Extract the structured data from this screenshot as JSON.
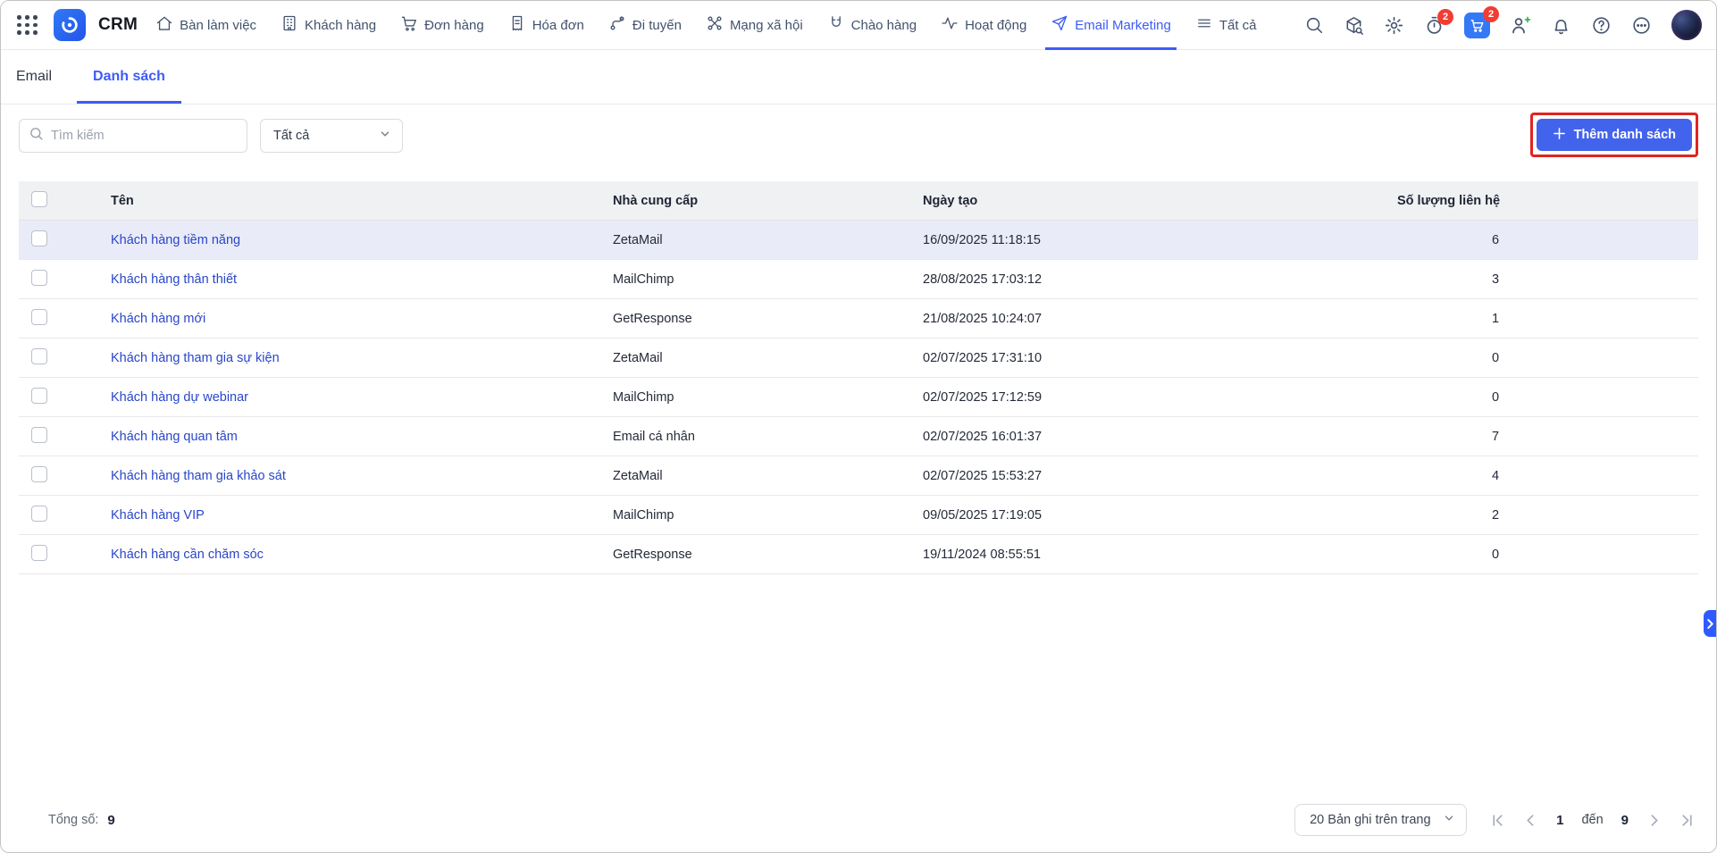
{
  "topnav": {
    "app_name": "CRM",
    "items": [
      {
        "label": "Bàn làm việc",
        "icon": "home-icon",
        "active": false
      },
      {
        "label": "Khách hàng",
        "icon": "building-icon",
        "active": false
      },
      {
        "label": "Đơn hàng",
        "icon": "cart-icon",
        "active": false
      },
      {
        "label": "Hóa đơn",
        "icon": "invoice-icon",
        "active": false
      },
      {
        "label": "Đi tuyến",
        "icon": "route-icon",
        "active": false
      },
      {
        "label": "Mạng xã hội",
        "icon": "network-icon",
        "active": false
      },
      {
        "label": "Chào hàng",
        "icon": "magnet-icon",
        "active": false
      },
      {
        "label": "Hoạt động",
        "icon": "activity-icon",
        "active": false
      },
      {
        "label": "Email Marketing",
        "icon": "send-icon",
        "active": true
      },
      {
        "label": "Tất cả",
        "icon": "menu-icon",
        "active": false
      }
    ],
    "right_icons": [
      {
        "name": "search-icon"
      },
      {
        "name": "package-search-icon"
      },
      {
        "name": "settings-gear-icon"
      },
      {
        "name": "timer-icon",
        "badge": "2"
      },
      {
        "name": "cart-app-icon",
        "badge": "2"
      },
      {
        "name": "add-user-icon"
      },
      {
        "name": "notifications-bell-icon"
      },
      {
        "name": "help-icon"
      },
      {
        "name": "more-icon"
      },
      {
        "name": "avatar"
      }
    ]
  },
  "tabs": [
    {
      "label": "Email",
      "active": false
    },
    {
      "label": "Danh sách",
      "active": true
    }
  ],
  "toolbar": {
    "search_placeholder": "Tìm kiếm",
    "filter_value": "Tất cả",
    "add_button_label": "Thêm danh sách"
  },
  "table": {
    "columns": [
      "Tên",
      "Nhà cung cấp",
      "Ngày tạo",
      "Số lượng liên hệ"
    ],
    "rows": [
      {
        "name": "Khách hàng tiềm năng",
        "provider": "ZetaMail",
        "created": "16/09/2025 11:18:15",
        "contacts": "6"
      },
      {
        "name": "Khách hàng thân thiết",
        "provider": "MailChimp",
        "created": "28/08/2025 17:03:12",
        "contacts": "3"
      },
      {
        "name": "Khách hàng mới",
        "provider": "GetResponse",
        "created": "21/08/2025 10:24:07",
        "contacts": "1"
      },
      {
        "name": "Khách hàng tham gia sự kiện",
        "provider": "ZetaMail",
        "created": "02/07/2025 17:31:10",
        "contacts": "0"
      },
      {
        "name": "Khách hàng dự webinar",
        "provider": "MailChimp",
        "created": "02/07/2025 17:12:59",
        "contacts": "0"
      },
      {
        "name": "Khách hàng quan tâm",
        "provider": "Email cá nhân",
        "created": "02/07/2025 16:01:37",
        "contacts": "7"
      },
      {
        "name": "Khách hàng tham gia khảo sát",
        "provider": "ZetaMail",
        "created": "02/07/2025 15:53:27",
        "contacts": "4"
      },
      {
        "name": "Khách hàng VIP",
        "provider": "MailChimp",
        "created": "09/05/2025 17:19:05",
        "contacts": "2"
      },
      {
        "name": "Khách hàng cần chăm sóc",
        "provider": "GetResponse",
        "created": "19/11/2024 08:55:51",
        "contacts": "0"
      }
    ]
  },
  "footer": {
    "total_label": "Tổng số:",
    "total_value": "9",
    "page_size_label": "20 Bản ghi trên trang",
    "current_page": "1",
    "separator": "đến",
    "last_page": "9"
  },
  "colors": {
    "accent": "#3d5cf5",
    "link": "#2946c9",
    "row_highlight": "#e9ebf9",
    "annotation_box": "#e02420",
    "badge": "#f23d32"
  }
}
